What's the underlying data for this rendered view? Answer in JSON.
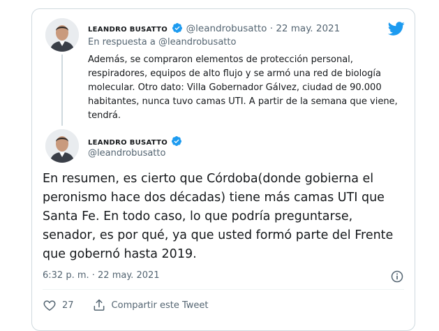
{
  "quoted_tweet": {
    "author_name": "LEANDRO BUSATTO",
    "handle": "@leandrobusatto",
    "separator": "·",
    "date": "22 may. 2021",
    "reply_to": "En respuesta a @leandrobusatto",
    "text": "Además, se compraron elementos de protección personal, respiradores, equipos de alto flujo y se armó una red de biología molecular. Otro dato: Villa Gobernador Gálvez, ciudad de 90.000 habitantes, nunca tuvo camas UTI. A partir de la semana que viene, tendrá."
  },
  "main_tweet": {
    "author_name": "LEANDRO BUSATTO",
    "handle": "@leandrobusatto",
    "text": "En resumen, es cierto que Córdoba(donde gobierna el peronismo hace dos décadas) tiene más camas UTI que Santa Fe. En todo caso, lo que podría preguntarse, senador, es por qué, ya que usted formó parte del Frente que gobernó hasta 2019.",
    "timestamp": "6:32 p. m. · 22 may. 2021",
    "like_count": "27",
    "share_label": "Compartir este Tweet"
  },
  "colors": {
    "twitter_blue": "#1d9bf0",
    "muted": "#536471",
    "border": "#cfd9de"
  },
  "icons": [
    "verified-badge-icon",
    "twitter-bird-icon",
    "info-icon",
    "heart-icon",
    "share-icon"
  ]
}
